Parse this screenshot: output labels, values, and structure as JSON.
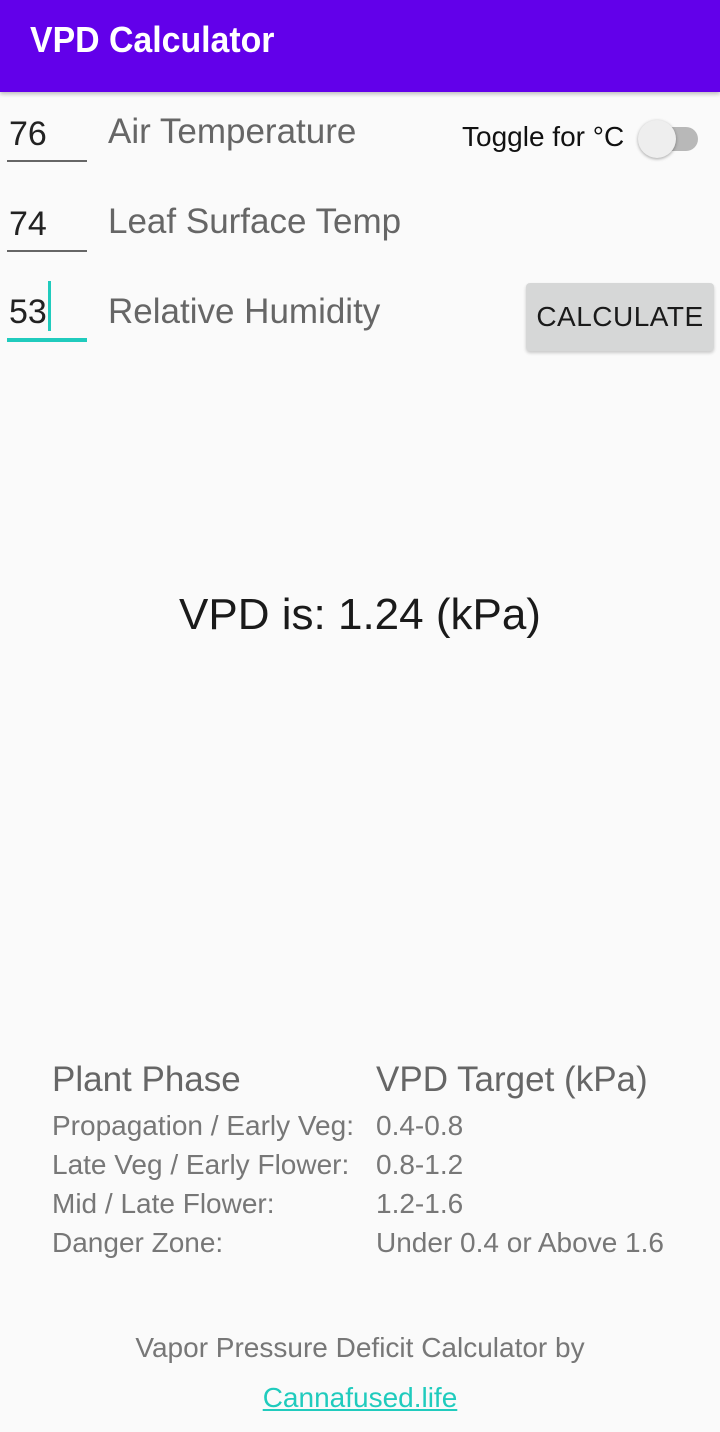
{
  "app": {
    "title": "VPD Calculator",
    "accent_color": "#6200ea",
    "link_color": "#20cbbd"
  },
  "inputs": {
    "air_temp": {
      "value": "76",
      "label": "Air Temperature"
    },
    "leaf_temp": {
      "value": "74",
      "label": "Leaf Surface Temp"
    },
    "humidity": {
      "value": "53",
      "label": "Relative Humidity"
    }
  },
  "toggle": {
    "label": "Toggle for °C",
    "checked": false
  },
  "calculate_button": {
    "label": "CALCULATE"
  },
  "result": {
    "text": "VPD is: 1.24 (kPa)"
  },
  "table": {
    "headers": [
      "Plant Phase",
      "VPD Target (kPa)"
    ],
    "rows": [
      {
        "phase": "Propagation / Early Veg:",
        "target": "0.4-0.8"
      },
      {
        "phase": "Late Veg / Early Flower:",
        "target": "0.8-1.2"
      },
      {
        "phase": "Mid / Late Flower:",
        "target": "1.2-1.6"
      },
      {
        "phase": "Danger Zone:",
        "target": "Under 0.4 or Above 1.6"
      }
    ]
  },
  "footer": {
    "text": "Vapor Pressure Deficit Calculator by",
    "link": "Cannafused.life"
  }
}
